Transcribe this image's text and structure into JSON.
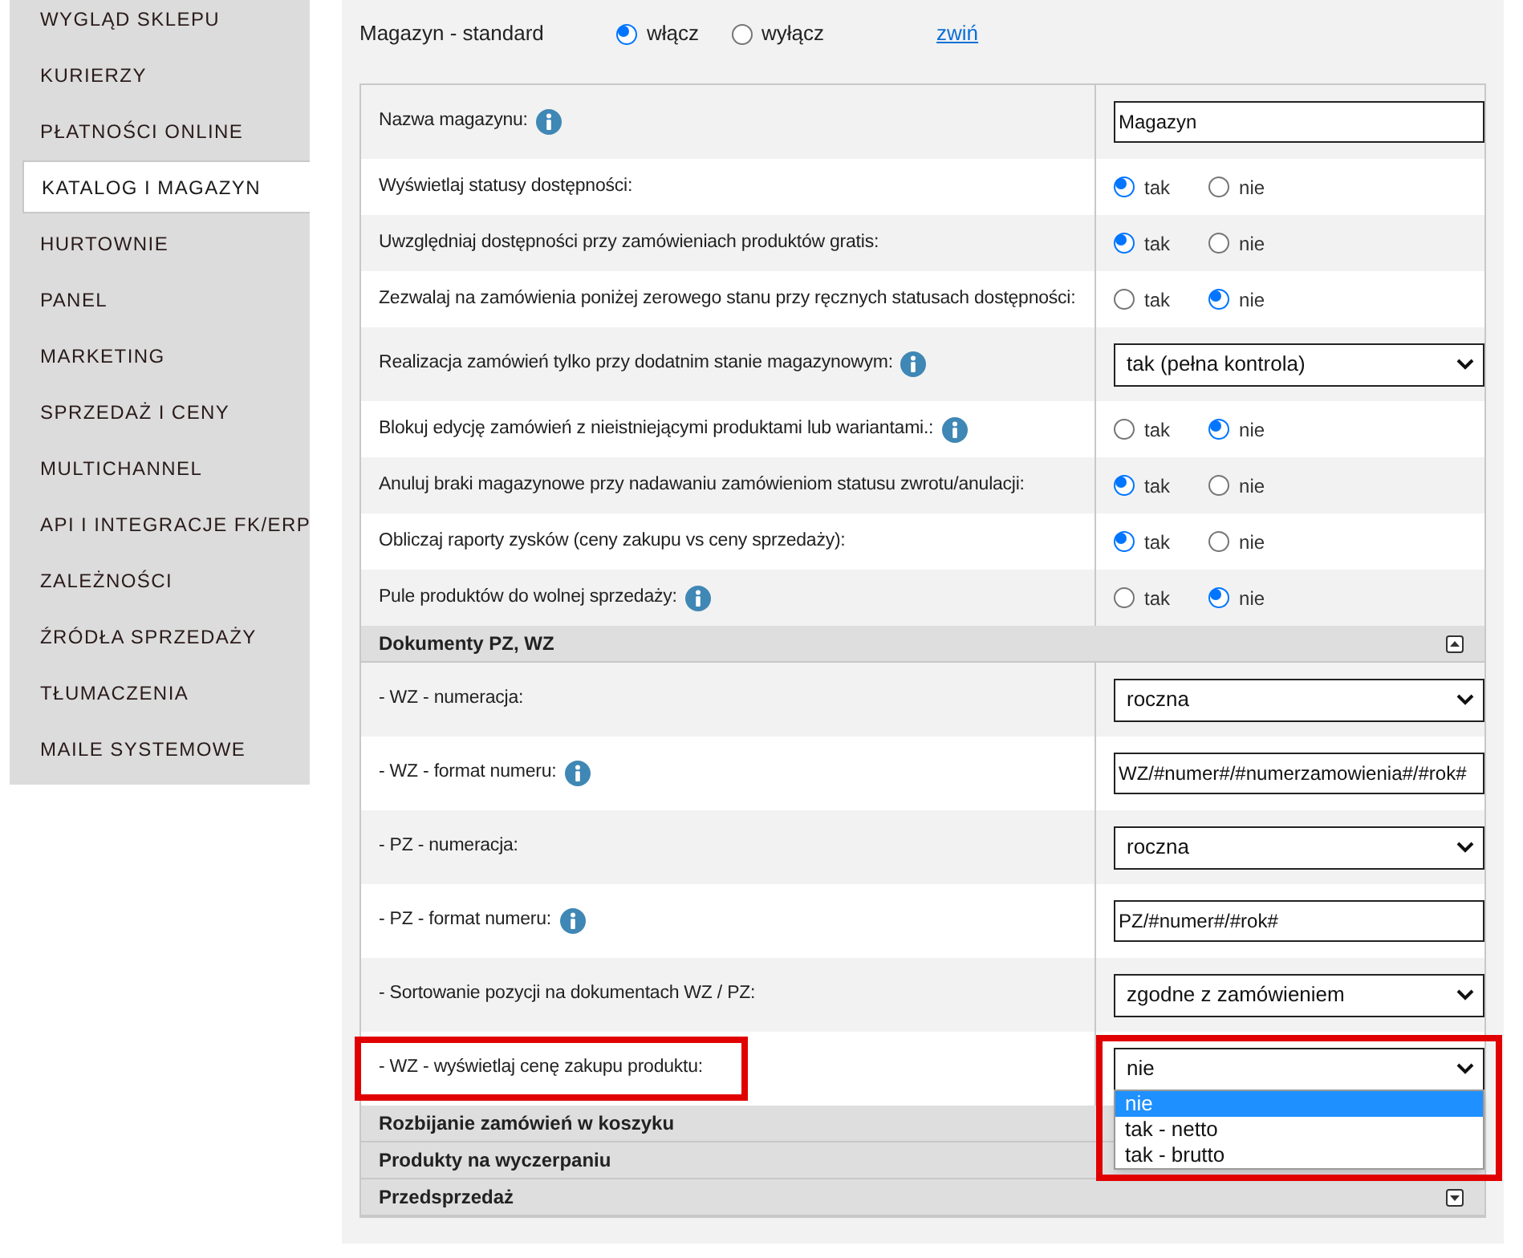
{
  "sidebar": {
    "items": [
      {
        "label": "WYGLĄD SKLEPU",
        "selected": false
      },
      {
        "label": "KURIERZY",
        "selected": false
      },
      {
        "label": "PŁATNOŚCI ONLINE",
        "selected": false
      },
      {
        "label": "KATALOG I MAGAZYN",
        "selected": true
      },
      {
        "label": "HURTOWNIE",
        "selected": false
      },
      {
        "label": "PANEL",
        "selected": false
      },
      {
        "label": "MARKETING",
        "selected": false
      },
      {
        "label": "SPRZEDAŻ I CENY",
        "selected": false
      },
      {
        "label": "MULTICHANNEL",
        "selected": false
      },
      {
        "label": "API I INTEGRACJE FK/ERP",
        "selected": false
      },
      {
        "label": "ZALEŻNOŚCI",
        "selected": false
      },
      {
        "label": "ŹRÓDŁA SPRZEDAŻY",
        "selected": false
      },
      {
        "label": "TŁUMACZENIA",
        "selected": false
      },
      {
        "label": "MAILE SYSTEMOWE",
        "selected": false
      }
    ]
  },
  "header": {
    "title": "Magazyn - standard",
    "options": [
      {
        "label": "włącz",
        "selected": true
      },
      {
        "label": "wyłącz",
        "selected": false
      }
    ],
    "link": "zwiń"
  },
  "settings": [
    {
      "kind": "text",
      "label": "Nazwa magazynu:",
      "info": true,
      "value": "Magazyn"
    },
    {
      "kind": "radio",
      "label": "Wyświetlaj statusy dostępności:",
      "info": false,
      "options": [
        {
          "label": "tak",
          "selected": true
        },
        {
          "label": "nie",
          "selected": false
        }
      ]
    },
    {
      "kind": "radio",
      "label": "Uwzględniaj dostępności przy zamówieniach produktów gratis:",
      "info": false,
      "options": [
        {
          "label": "tak",
          "selected": true
        },
        {
          "label": "nie",
          "selected": false
        }
      ]
    },
    {
      "kind": "radio",
      "label": "Zezwalaj na zamówienia poniżej zerowego stanu przy ręcznych statusach dostępności:",
      "info": false,
      "options": [
        {
          "label": "tak",
          "selected": false
        },
        {
          "label": "nie",
          "selected": true
        }
      ]
    },
    {
      "kind": "select",
      "label": "Realizacja zamówień tylko przy dodatnim stanie magazynowym:",
      "info": true,
      "value": "tak (pełna kontrola)"
    },
    {
      "kind": "radio",
      "label": "Blokuj edycję zamówień z nieistniejącymi produktami lub wariantami.:",
      "info": true,
      "options": [
        {
          "label": "tak",
          "selected": false
        },
        {
          "label": "nie",
          "selected": true
        }
      ]
    },
    {
      "kind": "radio",
      "label": "Anuluj braki magazynowe przy nadawaniu zamówieniom statusu zwrotu/anulacji:",
      "info": false,
      "options": [
        {
          "label": "tak",
          "selected": true
        },
        {
          "label": "nie",
          "selected": false
        }
      ]
    },
    {
      "kind": "radio",
      "label": "Obliczaj raporty zysków (ceny zakupu vs ceny sprzedaży):",
      "info": false,
      "options": [
        {
          "label": "tak",
          "selected": true
        },
        {
          "label": "nie",
          "selected": false
        }
      ]
    },
    {
      "kind": "radio",
      "label": "Pule produktów do wolnej sprzedaży:",
      "info": true,
      "options": [
        {
          "label": "tak",
          "selected": false
        },
        {
          "label": "nie",
          "selected": true
        }
      ]
    }
  ],
  "sections": [
    {
      "title": "Dokumenty PZ, WZ",
      "expanded": true,
      "settings": [
        {
          "kind": "select",
          "label": "- WZ - numeracja:",
          "info": false,
          "value": "roczna"
        },
        {
          "kind": "text",
          "label": "- WZ - format numeru:",
          "info": true,
          "value": "WZ/#numer#/#numerzamowienia#/#rok#"
        },
        {
          "kind": "select",
          "label": "- PZ - numeracja:",
          "info": false,
          "value": "roczna"
        },
        {
          "kind": "text",
          "label": "- PZ - format numeru:",
          "info": true,
          "value": "PZ/#numer#/#rok#"
        },
        {
          "kind": "select",
          "label": "- Sortowanie pozycji na dokumentach WZ / PZ:",
          "info": false,
          "value": "zgodne z zamówieniem"
        },
        {
          "kind": "select",
          "label": "- WZ - wyświetlaj cenę zakupu produktu:",
          "info": false,
          "value": "nie",
          "highlighted": true,
          "open": true,
          "options": [
            {
              "label": "nie",
              "selected": true
            },
            {
              "label": "tak - netto",
              "selected": false
            },
            {
              "label": "tak - brutto",
              "selected": false
            }
          ]
        }
      ]
    },
    {
      "title": "Rozbijanie zamówień w koszyku"
    },
    {
      "title": "Produkty na wyczerpaniu"
    },
    {
      "title": "Przedsprzedaż",
      "expanded": false
    }
  ]
}
